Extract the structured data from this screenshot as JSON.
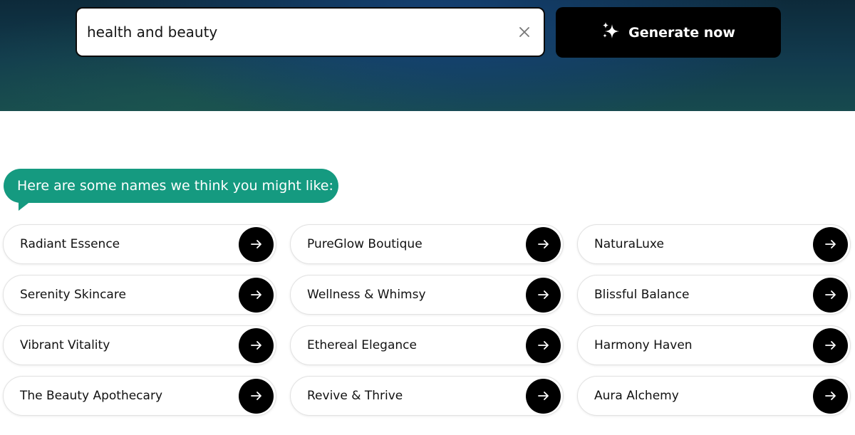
{
  "search": {
    "value": "health and beauty",
    "clear_icon": "close-icon"
  },
  "generate": {
    "label": "Generate now",
    "icon": "sparkles-icon"
  },
  "suggestions_heading": "Here are some names we think you might like:",
  "names": [
    "Radiant Essence",
    "PureGlow Boutique",
    "NaturaLuxe",
    "Serenity Skincare",
    "Wellness & Whimsy",
    "Blissful Balance",
    "Vibrant Vitality",
    "Ethereal Elegance",
    "Harmony Haven",
    "The Beauty Apothecary",
    "Revive & Thrive",
    "Aura Alchemy"
  ],
  "colors": {
    "accent": "#159a80",
    "button": "#000000"
  }
}
